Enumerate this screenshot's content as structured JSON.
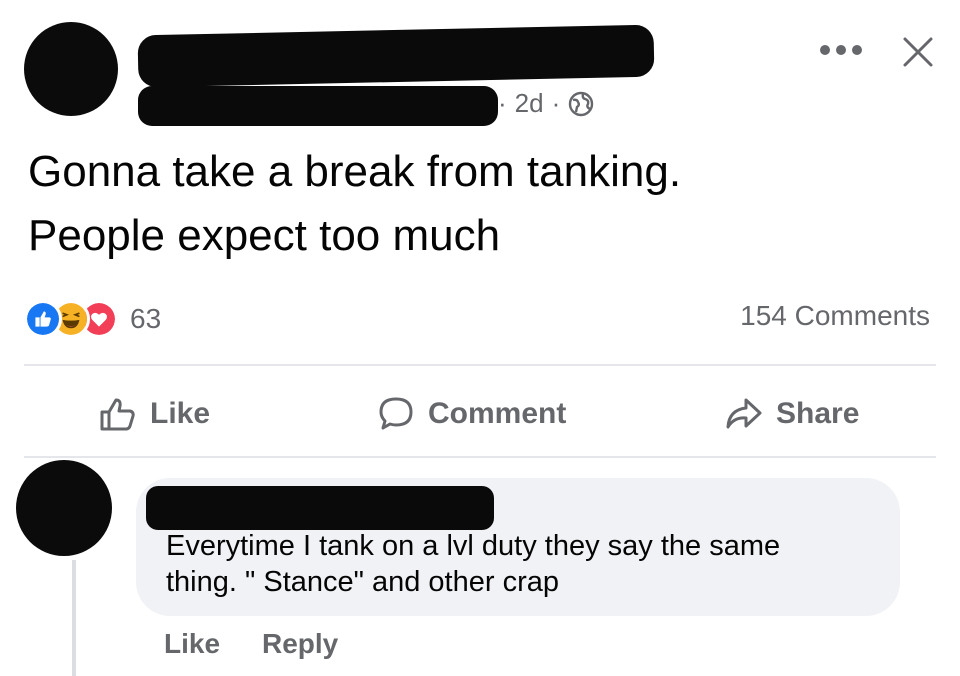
{
  "post": {
    "timestamp": "2d",
    "separator_dot": "·",
    "privacy_icon": "globe-icon",
    "text_line_1": "Gonna take a break from tanking.",
    "text_line_2": "People expect too much",
    "reaction_icons": [
      "like-icon",
      "haha-icon",
      "love-icon"
    ],
    "reaction_count": "63",
    "comments_count": "154 Comments"
  },
  "actions": {
    "like_label": "Like",
    "comment_label": "Comment",
    "share_label": "Share"
  },
  "comment": {
    "text_line_1": "Everytime I tank on a lvl duty they say the same",
    "text_line_2": "thing. \" Stance\" and other crap",
    "like_label": "Like",
    "reply_label": "Reply"
  },
  "colors": {
    "like_blue": "#1877f2",
    "haha_yellow": "#f7b125",
    "love_red": "#f33e58",
    "muted_text": "#65676b",
    "bubble_bg": "#f0f2f5"
  }
}
